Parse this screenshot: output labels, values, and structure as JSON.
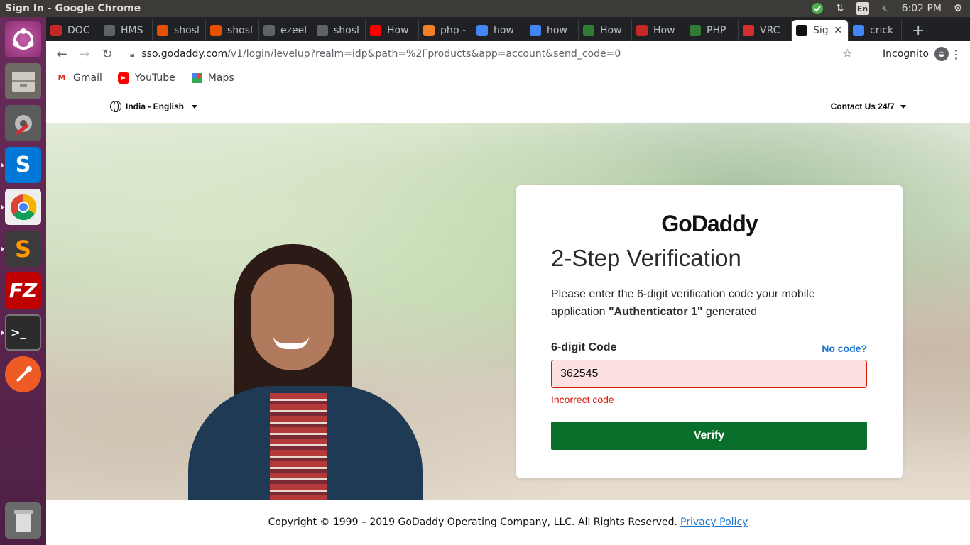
{
  "window": {
    "title": "Sign In - Google Chrome"
  },
  "tray": {
    "lang": "En",
    "time": "6:02 PM"
  },
  "tabs": [
    {
      "label": "DOC",
      "icon": "doc-icon",
      "color": "#c62828"
    },
    {
      "label": "HMS",
      "icon": "globe-icon",
      "color": "#5f6368"
    },
    {
      "label": "shosl",
      "icon": "ship-icon",
      "color": "#e65100"
    },
    {
      "label": "shosl",
      "icon": "ship-icon",
      "color": "#e65100"
    },
    {
      "label": "ezeel",
      "icon": "globe-icon",
      "color": "#5f6368"
    },
    {
      "label": "shosl",
      "icon": "globe-icon",
      "color": "#5f6368"
    },
    {
      "label": "How",
      "icon": "youtube-icon",
      "color": "#ff0000"
    },
    {
      "label": "php -",
      "icon": "stackoverflow-icon",
      "color": "#f48024"
    },
    {
      "label": "how",
      "icon": "google-icon",
      "color": "#4285f4"
    },
    {
      "label": "how",
      "icon": "google-icon",
      "color": "#4285f4"
    },
    {
      "label": "How",
      "icon": "gg-icon",
      "color": "#2e7d32"
    },
    {
      "label": "How",
      "icon": "cw-icon",
      "color": "#c62828"
    },
    {
      "label": "PHP",
      "icon": "gg-icon",
      "color": "#2e7d32"
    },
    {
      "label": "VRC",
      "icon": "vrc-icon",
      "color": "#d32f2f"
    },
    {
      "label": "Sig",
      "icon": "godaddy-icon",
      "color": "#111111",
      "active": true
    },
    {
      "label": "crick",
      "icon": "google-icon",
      "color": "#4285f4"
    }
  ],
  "omnibar": {
    "url_host": "sso.godaddy.com",
    "url_path": "/v1/login/levelup?realm=idp&path=%2Fproducts&app=account&send_code=0",
    "incognito_label": "Incognito"
  },
  "bookmarks": [
    {
      "label": "Gmail",
      "icon": "gmail-icon"
    },
    {
      "label": "YouTube",
      "icon": "youtube-icon"
    },
    {
      "label": "Maps",
      "icon": "maps-icon"
    }
  ],
  "header": {
    "locale": "India - English",
    "contact": "Contact Us 24/7"
  },
  "card": {
    "logo": "GoDaddy",
    "title": "2-Step Verification",
    "desc_before": "Please enter the 6-digit verification code your mobile application ",
    "desc_app": "\"Authenticator 1\"",
    "desc_after": " generated",
    "code_label": "6-digit Code",
    "no_code": "No code?",
    "code_value": "362545",
    "error": "Incorrect code",
    "verify_label": "Verify"
  },
  "footer": {
    "copyright": "Copyright © 1999 – 2019 GoDaddy Operating Company, LLC. All Rights Reserved.",
    "privacy": "Privacy Policy"
  },
  "colors": {
    "brand_green": "#09702b",
    "error_red": "#db1802",
    "link_blue": "#1976d2"
  }
}
